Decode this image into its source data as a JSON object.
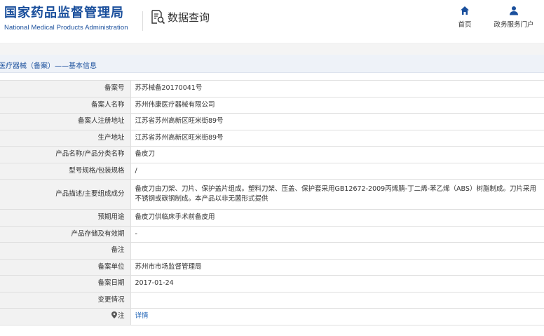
{
  "header": {
    "logo_cn": "国家药品监督管理局",
    "logo_en": "National Medical Products Administration",
    "query_label": "数据查询",
    "nav": [
      {
        "label": "首页",
        "icon": "home-icon"
      },
      {
        "label": "政务服务门户",
        "icon": "user-icon"
      }
    ]
  },
  "breadcrumb": "医疗器械（备案）——基本信息",
  "colors": {
    "brand": "#1a4f9c",
    "link": "#1a5fb4",
    "label_bg": "#f2f2f2"
  },
  "rows": [
    {
      "label": "备案号",
      "value": "苏苏械备20170041号"
    },
    {
      "label": "备案人名称",
      "value": "苏州伟康医疗器械有限公司"
    },
    {
      "label": "备案人注册地址",
      "value": "江苏省苏州高新区旺米街89号"
    },
    {
      "label": "生产地址",
      "value": "江苏省苏州高新区旺米街89号"
    },
    {
      "label": "产品名称/产品分类名称",
      "value": "备皮刀"
    },
    {
      "label": "型号规格/包装规格",
      "value": "/"
    },
    {
      "label": "产品描述/主要组成成分",
      "value": "备皮刀由刀架、刀片、保护盖片组成。塑料刀架、压盖、保护套采用GB12672-2009丙烯腈-丁二烯-苯乙烯（ABS）树脂制成。刀片采用不锈钢或碳钢制成。本产品以非无菌形式提供"
    },
    {
      "label": "预期用途",
      "value": "备皮刀供临床手术前备皮用"
    },
    {
      "label": "产品存储及有效期",
      "value": "-"
    },
    {
      "label": "备注",
      "value": ""
    },
    {
      "label": "备案单位",
      "value": "苏州市市场监督管理局"
    },
    {
      "label": "备案日期",
      "value": "2017-01-24"
    },
    {
      "label": "变更情况",
      "value": ""
    },
    {
      "label": "注",
      "value": "详情",
      "icon": "pin-icon"
    }
  ]
}
